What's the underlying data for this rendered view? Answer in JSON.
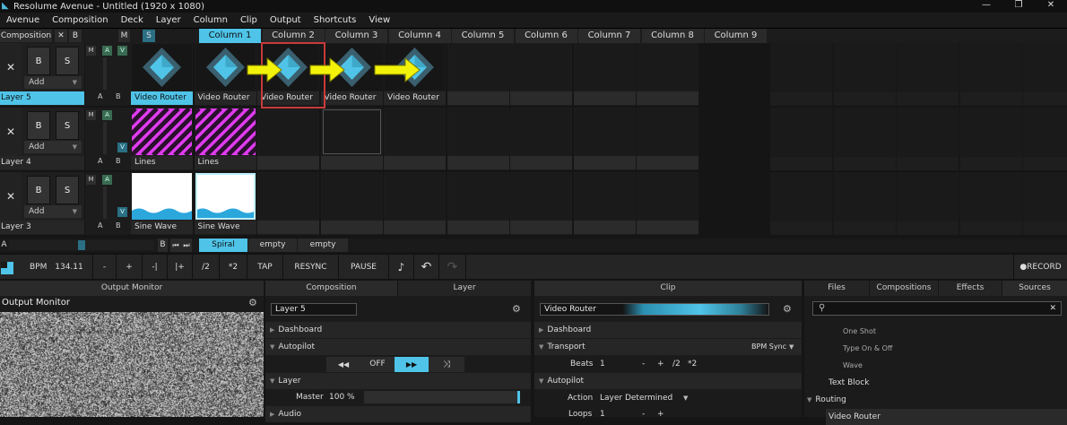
{
  "window": {
    "title": "Resolume Avenue - Untitled (1920 x 1080)",
    "minimize": "—",
    "maximize": "❐",
    "close": "✕"
  },
  "menu": [
    "Avenue",
    "Composition",
    "Deck",
    "Layer",
    "Column",
    "Clip",
    "Output",
    "Shortcuts",
    "View"
  ],
  "composition_header": {
    "label": "Composition",
    "x": "✕",
    "b": "B",
    "m": "M",
    "s": "S"
  },
  "columns": [
    "Column 1",
    "Column 2",
    "Column 3",
    "Column 4",
    "Column 5",
    "Column 6",
    "Column 7",
    "Column 8",
    "Column 9"
  ],
  "active_column": 0,
  "layers": [
    {
      "name": "Layer 5",
      "selected": true,
      "add_label": "Add",
      "x": "✕",
      "b": "B",
      "s": "S",
      "m": "M",
      "a": "A",
      "v": "V",
      "ab_a": "A",
      "ab_b": "B",
      "clips": [
        "Video Router",
        "Video Router",
        "Video Router",
        "Video Router",
        "Video Router",
        "",
        "",
        "",
        ""
      ]
    },
    {
      "name": "Layer 4",
      "selected": false,
      "add_label": "Add",
      "x": "✕",
      "b": "B",
      "s": "S",
      "m": "M",
      "a": "A",
      "v": "V",
      "ab_a": "A",
      "ab_b": "B",
      "clips": [
        "Lines",
        "Lines",
        "",
        "",
        "",
        "",
        "",
        "",
        ""
      ]
    },
    {
      "name": "Layer 3",
      "selected": false,
      "add_label": "Add",
      "x": "✕",
      "b": "B",
      "s": "S",
      "m": "M",
      "a": "A",
      "v": "V",
      "ab_a": "A",
      "ab_b": "B",
      "clips": [
        "Sine Wave",
        "Sine Wave",
        "",
        "",
        "",
        "",
        "",
        "",
        ""
      ]
    }
  ],
  "deck_bar": {
    "a": "A",
    "b": "B",
    "prev": "⏮",
    "next": "⏭",
    "decks": [
      "Spiral",
      "empty",
      "empty"
    ],
    "active_deck": 0
  },
  "transport": {
    "bpm_label": "BPM",
    "bpm_value": "134.11",
    "minus": "-",
    "plus": "+",
    "nudge_minus": "-|",
    "nudge_plus": "|+",
    "half": "/2",
    "double": "*2",
    "tap": "TAP",
    "resync": "RESYNC",
    "pause": "PAUSE",
    "metronome": "♪",
    "undo": "↶",
    "redo": "↷",
    "record": "●RECORD"
  },
  "output_monitor": {
    "tab": "Output Monitor",
    "title": "Output Monitor",
    "gear": "⚙"
  },
  "composition_panel": {
    "tab_composition": "Composition",
    "tab_layer": "Layer",
    "layer_name": "Layer 5",
    "gear": "⚙",
    "dashboard": "Dashboard",
    "autopilot": "Autopilot",
    "autopilot_buttons": [
      "◀◀",
      "OFF",
      "▶▶",
      "⤨"
    ],
    "autopilot_active": 2,
    "layer_section": "Layer",
    "master_label": "Master",
    "master_value": "100 %",
    "master_level": 1.0,
    "audio": "Audio"
  },
  "clip_panel": {
    "tab": "Clip",
    "clip_name": "Video Router",
    "gear": "⚙",
    "dashboard": "Dashboard",
    "transport": "Transport",
    "bpm_sync": "BPM Sync",
    "beats_label": "Beats",
    "beats_value": "1",
    "beats_minus": "-",
    "beats_plus": "+",
    "beats_half": "/2",
    "beats_double": "*2",
    "autopilot": "Autopilot",
    "action_label": "Action",
    "action_value": "Layer Determined",
    "loops_label": "Loops",
    "loops_value": "1",
    "loops_minus": "-",
    "loops_plus": "+"
  },
  "sources_panel": {
    "tabs": [
      "Files",
      "Compositions",
      "Effects",
      "Sources"
    ],
    "active_tab": 3,
    "search_placeholder": "",
    "clear": "✕",
    "items": [
      {
        "label": "One Shot",
        "indent": 2
      },
      {
        "label": "Type On & Off",
        "indent": 2
      },
      {
        "label": "Wave",
        "indent": 2
      },
      {
        "label": "Text Block",
        "indent": 1
      },
      {
        "label": "Routing",
        "indent": 0,
        "group": true
      },
      {
        "label": "Video Router",
        "indent": 1,
        "selected": true
      }
    ]
  },
  "colors": {
    "accent": "#4fc4e8",
    "magenta": "#e03cf0",
    "arrow_yellow": "#f2f20a",
    "highlight_red": "#c83a3a"
  }
}
